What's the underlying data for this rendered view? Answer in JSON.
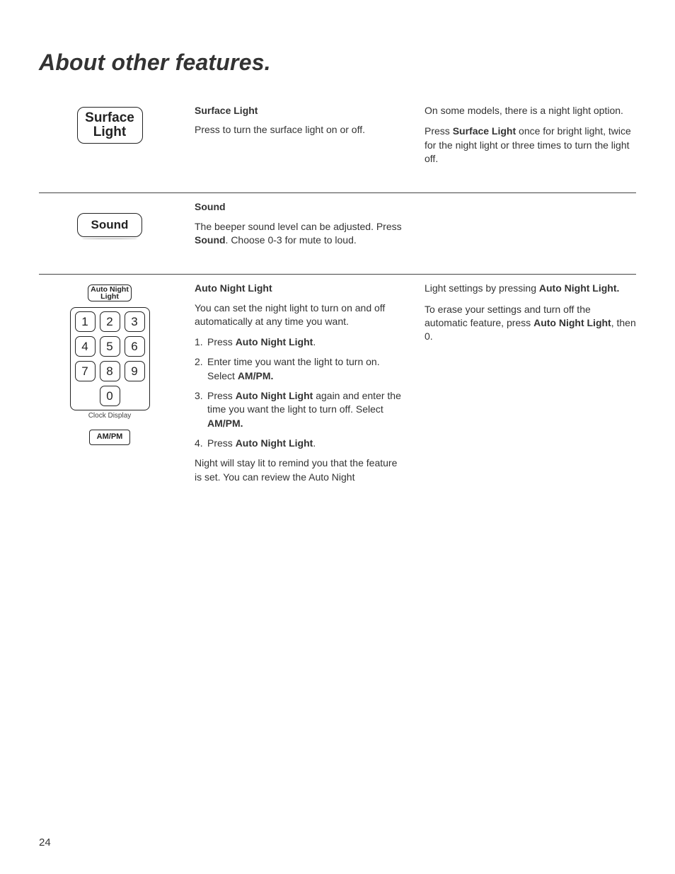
{
  "page": {
    "title": "About other features.",
    "number": "24"
  },
  "sections": {
    "surfaceLight": {
      "buttonLabel": "Surface\nLight",
      "heading": "Surface Light",
      "para1": "Press to turn the surface light on or off.",
      "rightPara1": "On some models, there is a night light option.",
      "rightPara2_pre": "Press ",
      "rightPara2_bold": "Surface Light",
      "rightPara2_post": " once for bright light, twice for the night light or three times to turn the light off."
    },
    "sound": {
      "buttonLabel": "Sound",
      "heading": "Sound",
      "para1_pre": "The beeper sound level can be adjusted. Press ",
      "para1_bold": "Sound",
      "para1_post": ". Choose 0-3 for mute to loud."
    },
    "autoNightLight": {
      "btnAutoNight": "Auto Night\nLight",
      "keys": [
        "1",
        "2",
        "3",
        "4",
        "5",
        "6",
        "7",
        "8",
        "9",
        "0"
      ],
      "clockDisplay": "Clock Display",
      "ampm": "AM/PM",
      "heading": "Auto Night Light",
      "intro": "You can set the night light to turn on and off automatically at any time you want.",
      "step1_pre": "Press ",
      "step1_bold": "Auto Night Light",
      "step1_post": ".",
      "step2_pre": "Enter time you want the light to turn on. Select ",
      "step2_bold": "AM/PM.",
      "step3_pre": "Press  ",
      "step3_bold": "Auto Night Light",
      "step3_mid": " again and enter the time you want the light to turn off. Select ",
      "step3_bold2": "AM/PM.",
      "step4_pre": "Press ",
      "step4_bold": "Auto Night Light",
      "step4_post": ".",
      "tail": "Night will stay lit to remind you that the feature is set.  You can review the Auto Night",
      "rightPara1_pre": "Light settings by pressing ",
      "rightPara1_bold": "Auto Night Light.",
      "rightPara2_pre": "To erase your settings  and turn off the automatic feature, press ",
      "rightPara2_bold": "Auto Night Light",
      "rightPara2_post": ", then 0."
    }
  }
}
